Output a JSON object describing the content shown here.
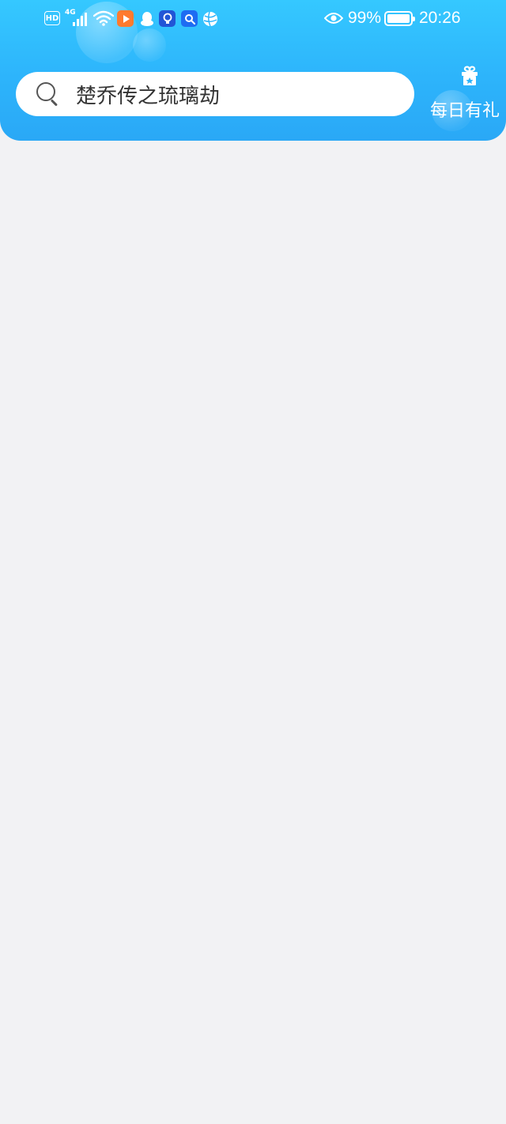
{
  "status_bar": {
    "hd_badge": "HD",
    "network_type": "4G",
    "signal_icon": "cell-signal-icon",
    "wifi_icon": "wifi-icon",
    "app_icons": [
      "video-app-icon",
      "qq-penguin-icon",
      "lightbulb-app-icon",
      "search-app-icon",
      "ball-app-icon"
    ],
    "eye_icon": "eye-care-icon",
    "battery_percent": "99%",
    "battery_level": 0.99,
    "time": "20:26"
  },
  "header": {
    "gradient_colors": [
      "#35c8ff",
      "#2aa8f6"
    ],
    "search": {
      "icon": "search-icon",
      "text": "楚乔传之琉璃劫"
    },
    "daily_gift": {
      "icon": "gift-icon",
      "label": "每日有礼"
    }
  }
}
